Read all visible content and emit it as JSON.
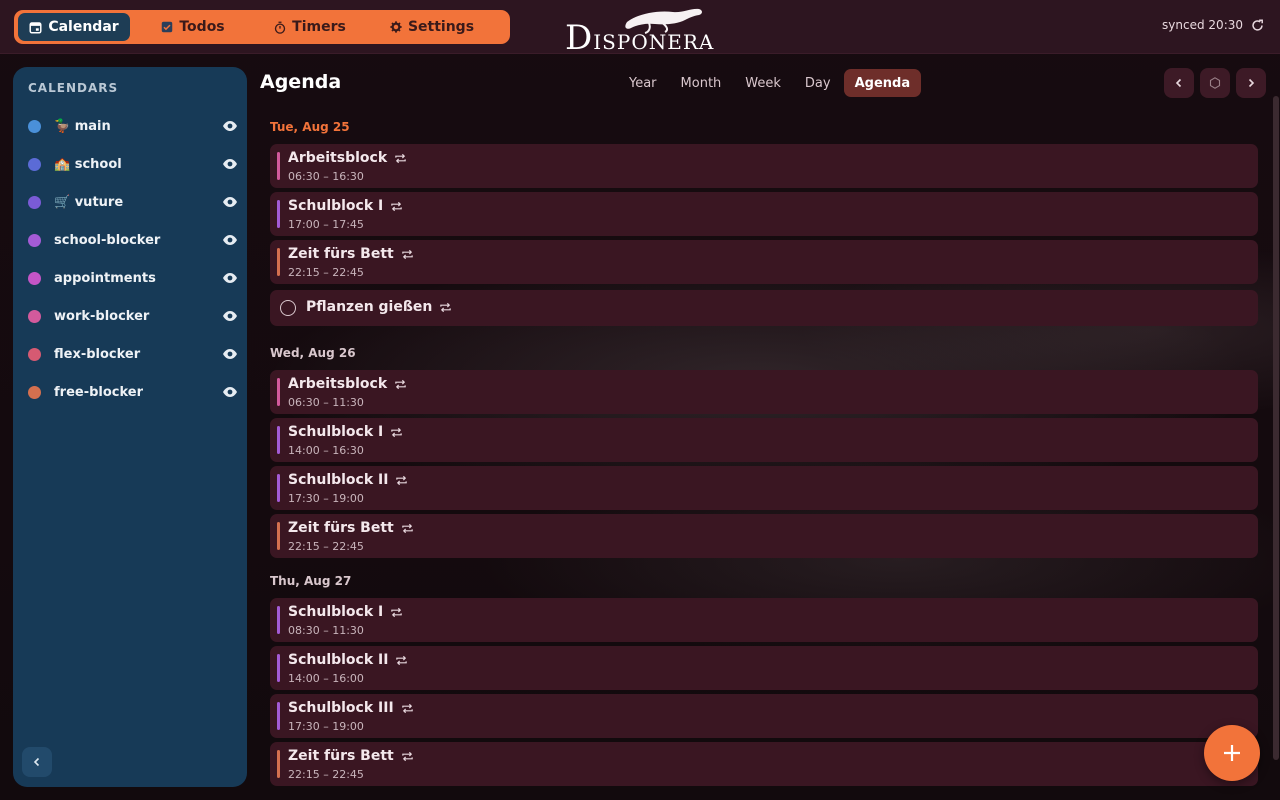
{
  "nav": {
    "tabs": [
      {
        "label": "Calendar",
        "icon": "calendar-icon",
        "active": true
      },
      {
        "label": "Todos",
        "icon": "checkbox-icon",
        "active": false
      },
      {
        "label": "Timers",
        "icon": "stopwatch-icon",
        "active": false
      },
      {
        "label": "Settings",
        "icon": "gear-icon",
        "active": false
      }
    ]
  },
  "logo": {
    "text_big_1": "D",
    "text_small_1": "ISP",
    "text_small_2": "ONERA",
    "text_big_2": "O"
  },
  "sync": {
    "status": "synced 20:30"
  },
  "sidebar": {
    "title": "CALENDARS",
    "calendars": [
      {
        "label": "🦆 main",
        "color": "#4a90d9"
      },
      {
        "label": "🏫 school",
        "color": "#5b6bd6"
      },
      {
        "label": "🛒 vuture",
        "color": "#7a5bd6"
      },
      {
        "label": "school-blocker",
        "color": "#a45bd6"
      },
      {
        "label": "appointments",
        "color": "#c455c6"
      },
      {
        "label": "work-blocker",
        "color": "#d35a9c"
      },
      {
        "label": "flex-blocker",
        "color": "#d65a72"
      },
      {
        "label": "free-blocker",
        "color": "#d4704f"
      }
    ]
  },
  "main": {
    "title": "Agenda",
    "views": [
      "Year",
      "Month",
      "Week",
      "Day",
      "Agenda"
    ],
    "active_view": "Agenda"
  },
  "agenda": {
    "days": [
      {
        "heading": "Tue, Aug 25",
        "color": "#f2733a",
        "items": [
          {
            "type": "event",
            "title": "Arbeitsblock",
            "time": "06:30 – 16:30",
            "color": "#d35a9c"
          },
          {
            "type": "event",
            "title": "Schulblock I",
            "time": "17:00 – 17:45",
            "color": "#a45bd6"
          },
          {
            "type": "event",
            "title": "Zeit fürs Bett",
            "time": "22:15 – 22:45",
            "color": "#d4704f"
          },
          {
            "type": "todo",
            "title": "Pflanzen gießen"
          }
        ]
      },
      {
        "heading": "Wed, Aug 26",
        "color": "#d9c7cd",
        "items": [
          {
            "type": "event",
            "title": "Arbeitsblock",
            "time": "06:30 – 11:30",
            "color": "#d35a9c"
          },
          {
            "type": "event",
            "title": "Schulblock I",
            "time": "14:00 – 16:30",
            "color": "#a45bd6"
          },
          {
            "type": "event",
            "title": "Schulblock II",
            "time": "17:30 – 19:00",
            "color": "#a45bd6"
          },
          {
            "type": "event",
            "title": "Zeit fürs Bett",
            "time": "22:15 – 22:45",
            "color": "#d4704f"
          }
        ]
      },
      {
        "heading": "Thu, Aug 27",
        "color": "#d9c7cd",
        "items": [
          {
            "type": "event",
            "title": "Schulblock I",
            "time": "08:30 – 11:30",
            "color": "#a45bd6"
          },
          {
            "type": "event",
            "title": "Schulblock II",
            "time": "14:00 – 16:00",
            "color": "#a45bd6"
          },
          {
            "type": "event",
            "title": "Schulblock III",
            "time": "17:30 – 19:00",
            "color": "#a45bd6"
          },
          {
            "type": "event",
            "title": "Zeit fürs Bett",
            "time": "22:15 – 22:45",
            "color": "#d4704f"
          }
        ]
      }
    ]
  },
  "icons": {
    "repeat": "repeat-icon",
    "visibility": "eye-icon",
    "fab": "plus-icon",
    "refresh": "refresh-icon"
  }
}
